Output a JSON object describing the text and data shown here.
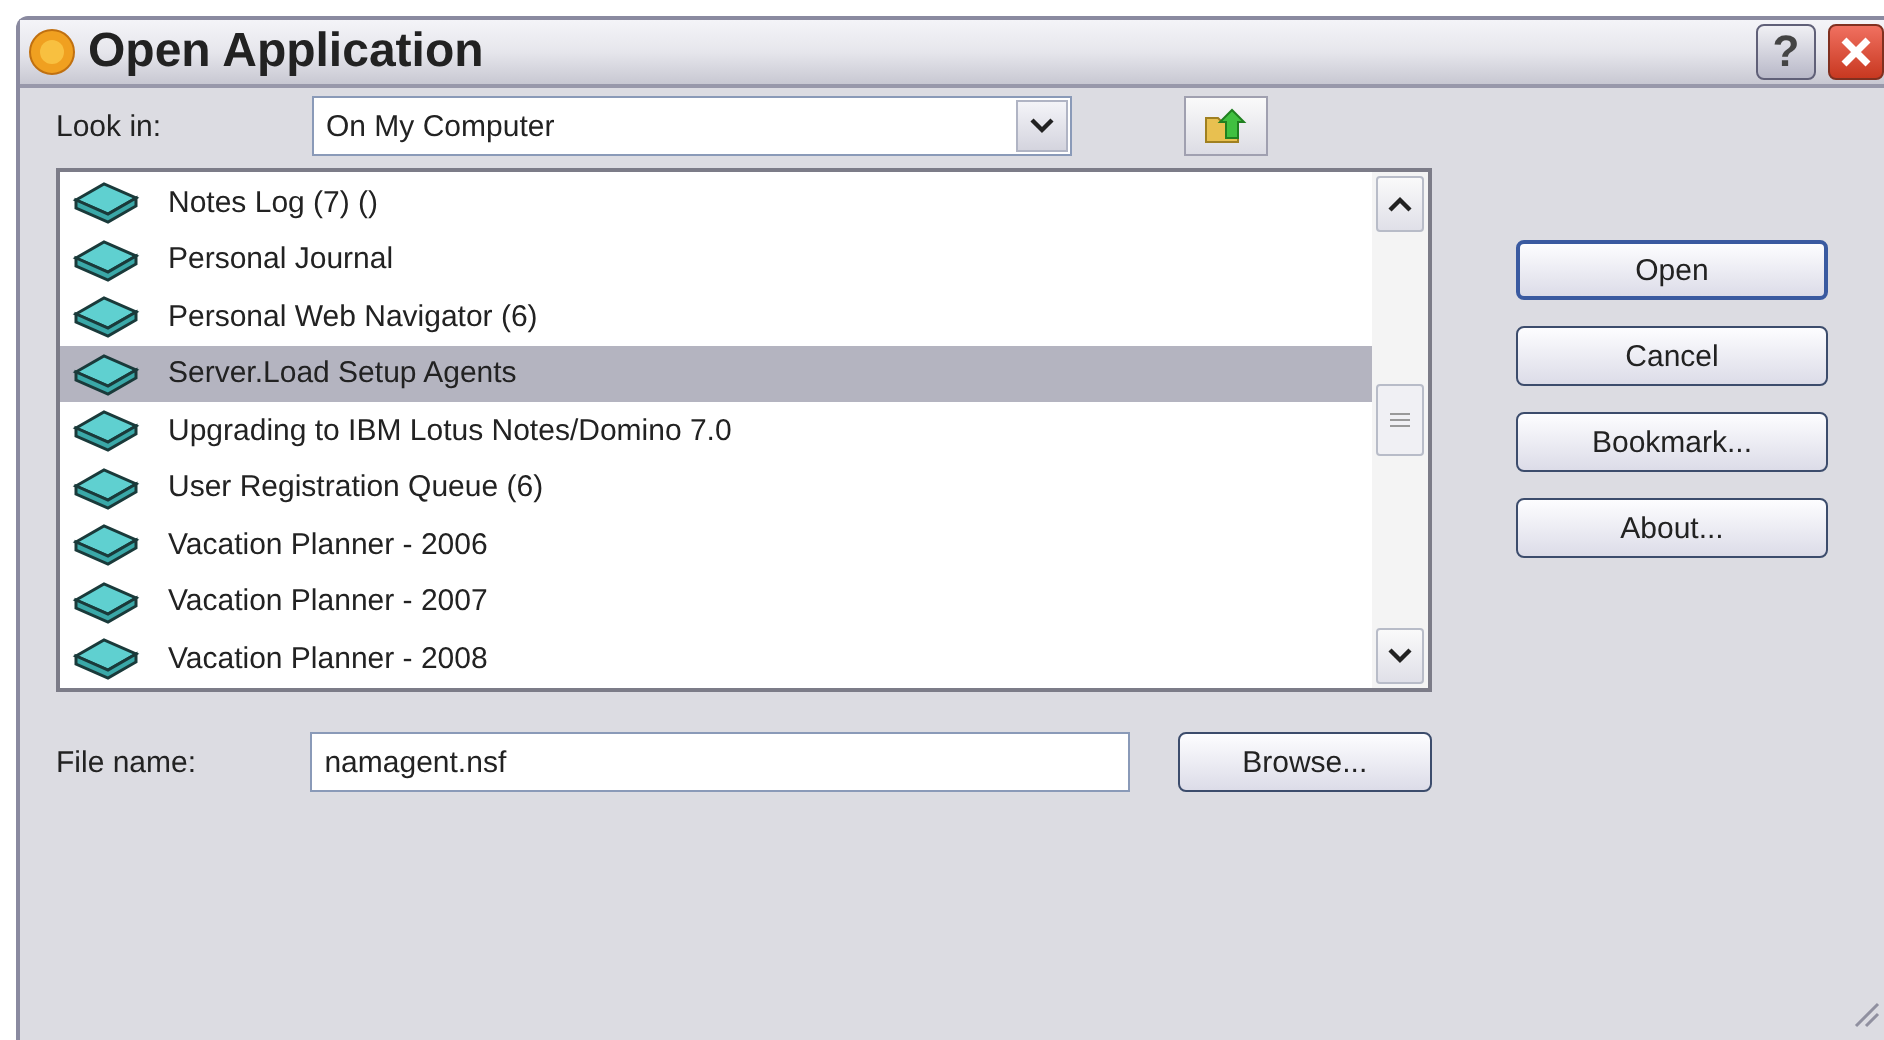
{
  "window": {
    "title": "Open Application",
    "help_button": "?"
  },
  "look_in": {
    "label": "Look in:",
    "value": "On My Computer"
  },
  "list": {
    "items": [
      {
        "label": "Notes Log (7) ()",
        "selected": false
      },
      {
        "label": "Personal Journal",
        "selected": false
      },
      {
        "label": "Personal Web Navigator (6)",
        "selected": false
      },
      {
        "label": "Server.Load Setup Agents",
        "selected": true
      },
      {
        "label": "Upgrading to IBM Lotus Notes/Domino 7.0",
        "selected": false
      },
      {
        "label": "User Registration Queue (6)",
        "selected": false
      },
      {
        "label": "Vacation Planner - 2006",
        "selected": false
      },
      {
        "label": "Vacation Planner - 2007",
        "selected": false
      },
      {
        "label": "Vacation Planner - 2008",
        "selected": false
      }
    ]
  },
  "buttons": [
    {
      "label": "Open",
      "default": true
    },
    {
      "label": "Cancel",
      "default": false
    },
    {
      "label": "Bookmark...",
      "default": false
    },
    {
      "label": "About...",
      "default": false
    }
  ],
  "file_name": {
    "label": "File name:",
    "value": "namagent.nsf"
  },
  "browse_button": "Browse..."
}
